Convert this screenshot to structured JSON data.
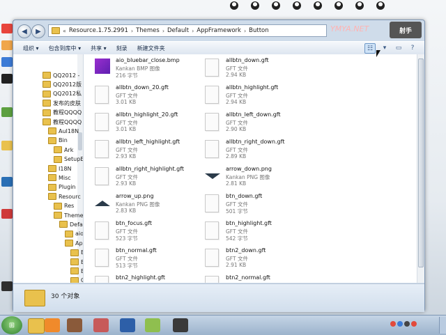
{
  "window": {
    "breadcrumb": [
      "Resource.1.75.2991",
      "Themes",
      "Default",
      "AppFramework",
      "Button"
    ],
    "watermark": "YMYA.NET",
    "logo_text": "射手"
  },
  "toolbar": {
    "organize": "组织 ▾",
    "include": "包含到库中 ▾",
    "share": "共享 ▾",
    "burn": "刻录",
    "new_folder": "新建文件夹"
  },
  "nav": {
    "items": [
      {
        "label": "QQ2012 -",
        "indent": 0
      },
      {
        "label": "QQ2012版",
        "indent": 0
      },
      {
        "label": "QQ2012私",
        "indent": 0
      },
      {
        "label": "发布的皮肤",
        "indent": 0
      },
      {
        "label": "教程QQQQ",
        "indent": 0
      },
      {
        "label": "教程QQQQ",
        "indent": 0
      },
      {
        "label": "AuI18N",
        "indent": 1
      },
      {
        "label": "Bin",
        "indent": 1
      },
      {
        "label": "Ark",
        "indent": 2
      },
      {
        "label": "SetupE",
        "indent": 2
      },
      {
        "label": "I18N",
        "indent": 1
      },
      {
        "label": "Misc",
        "indent": 1
      },
      {
        "label": "Plugin",
        "indent": 1
      },
      {
        "label": "Resourc",
        "indent": 1
      },
      {
        "label": "Res",
        "indent": 2
      },
      {
        "label": "Theme",
        "indent": 2
      },
      {
        "label": "Defau",
        "indent": 3
      },
      {
        "label": "aio",
        "indent": 4
      },
      {
        "label": "App",
        "indent": 4
      },
      {
        "label": "B",
        "indent": 5
      },
      {
        "label": "B",
        "indent": 5
      },
      {
        "label": "B",
        "indent": 5
      },
      {
        "label": "C",
        "indent": 5
      }
    ]
  },
  "files": [
    {
      "name": "aio_bluebar_close.bmp",
      "type": "Kankan BMP 图像",
      "size": "216 字节",
      "icon": "bmp"
    },
    {
      "name": "allbtn_down.gft",
      "type": "GFT 文件",
      "size": "2.94 KB",
      "icon": "doc"
    },
    {
      "name": "allbtn_down_20.gft",
      "type": "GFT 文件",
      "size": "3.01 KB",
      "icon": "doc"
    },
    {
      "name": "allbtn_highlight.gft",
      "type": "GFT 文件",
      "size": "2.94 KB",
      "icon": "doc"
    },
    {
      "name": "allbtn_highlight_20.gft",
      "type": "GFT 文件",
      "size": "3.01 KB",
      "icon": "doc"
    },
    {
      "name": "allbtn_left_down.gft",
      "type": "GFT 文件",
      "size": "2.90 KB",
      "icon": "doc"
    },
    {
      "name": "allbtn_left_highlight.gft",
      "type": "GFT 文件",
      "size": "2.93 KB",
      "icon": "doc"
    },
    {
      "name": "allbtn_right_down.gft",
      "type": "GFT 文件",
      "size": "2.89 KB",
      "icon": "doc"
    },
    {
      "name": "allbtn_right_highlight.gft",
      "type": "GFT 文件",
      "size": "2.93 KB",
      "icon": "doc"
    },
    {
      "name": "arrow_down.png",
      "type": "Kankan PNG 图像",
      "size": "2.81 KB",
      "icon": "png-down"
    },
    {
      "name": "arrow_up.png",
      "type": "Kankan PNG 图像",
      "size": "2.83 KB",
      "icon": "png-up"
    },
    {
      "name": "btn_down.gft",
      "type": "GFT 文件",
      "size": "501 字节",
      "icon": "doc"
    },
    {
      "name": "btn_focus.gft",
      "type": "GFT 文件",
      "size": "523 字节",
      "icon": "doc"
    },
    {
      "name": "btn_highlight.gft",
      "type": "GFT 文件",
      "size": "542 字节",
      "icon": "doc"
    },
    {
      "name": "btn_normal.gft",
      "type": "GFT 文件",
      "size": "513 字节",
      "icon": "doc"
    },
    {
      "name": "btn2_down.gft",
      "type": "GFT 文件",
      "size": "2.91 KB",
      "icon": "doc"
    },
    {
      "name": "btn2_highlight.gft",
      "type": "GFT 文件",
      "size": "",
      "icon": "doc"
    },
    {
      "name": "btn2_normal.gft",
      "type": "GFT 文件",
      "size": "",
      "icon": "doc"
    }
  ],
  "details": {
    "count": "30 个对象"
  },
  "colors": {
    "accent": "#6d97c6",
    "folder": "#e9c14d",
    "window_frame": "#cfdcea"
  }
}
